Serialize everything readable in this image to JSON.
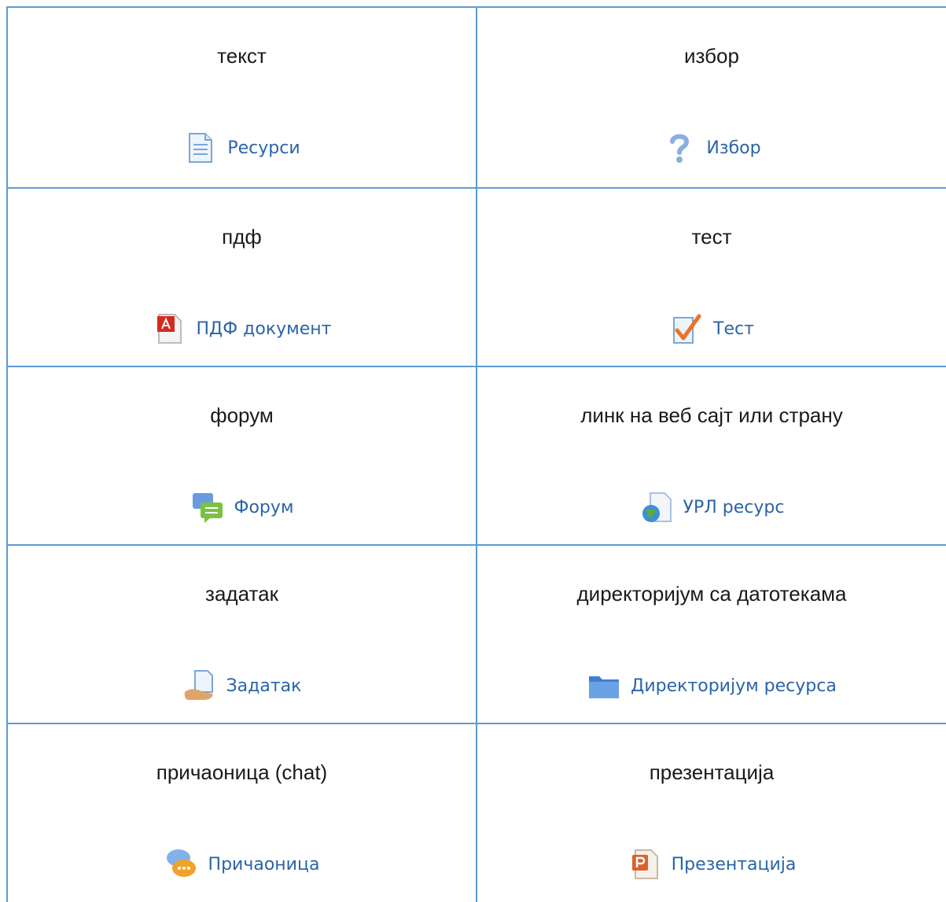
{
  "cells": [
    {
      "heading": "текст",
      "link": "Ресурси",
      "icon": "document-icon"
    },
    {
      "heading": "избор",
      "link": "Избор",
      "icon": "question-mark-icon"
    },
    {
      "heading": "пдф",
      "link": "ПДФ документ",
      "icon": "pdf-icon"
    },
    {
      "heading": "тест",
      "link": "Тест",
      "icon": "checkmark-quiz-icon"
    },
    {
      "heading": "форум",
      "link": "Форум",
      "icon": "forum-bubbles-icon"
    },
    {
      "heading": "линк на веб сајт или страну",
      "link": "УРЛ ресурс",
      "icon": "globe-page-icon"
    },
    {
      "heading": "задатак",
      "link": "Задатак",
      "icon": "hand-document-icon"
    },
    {
      "heading": "директоријум са датотекама",
      "link": "Директоријум ресурса",
      "icon": "folder-icon"
    },
    {
      "heading": "причаоница (chat)",
      "link": "Причаоница",
      "icon": "chat-bubbles-icon"
    },
    {
      "heading": "презентација",
      "link": "Презентација",
      "icon": "powerpoint-icon"
    }
  ]
}
